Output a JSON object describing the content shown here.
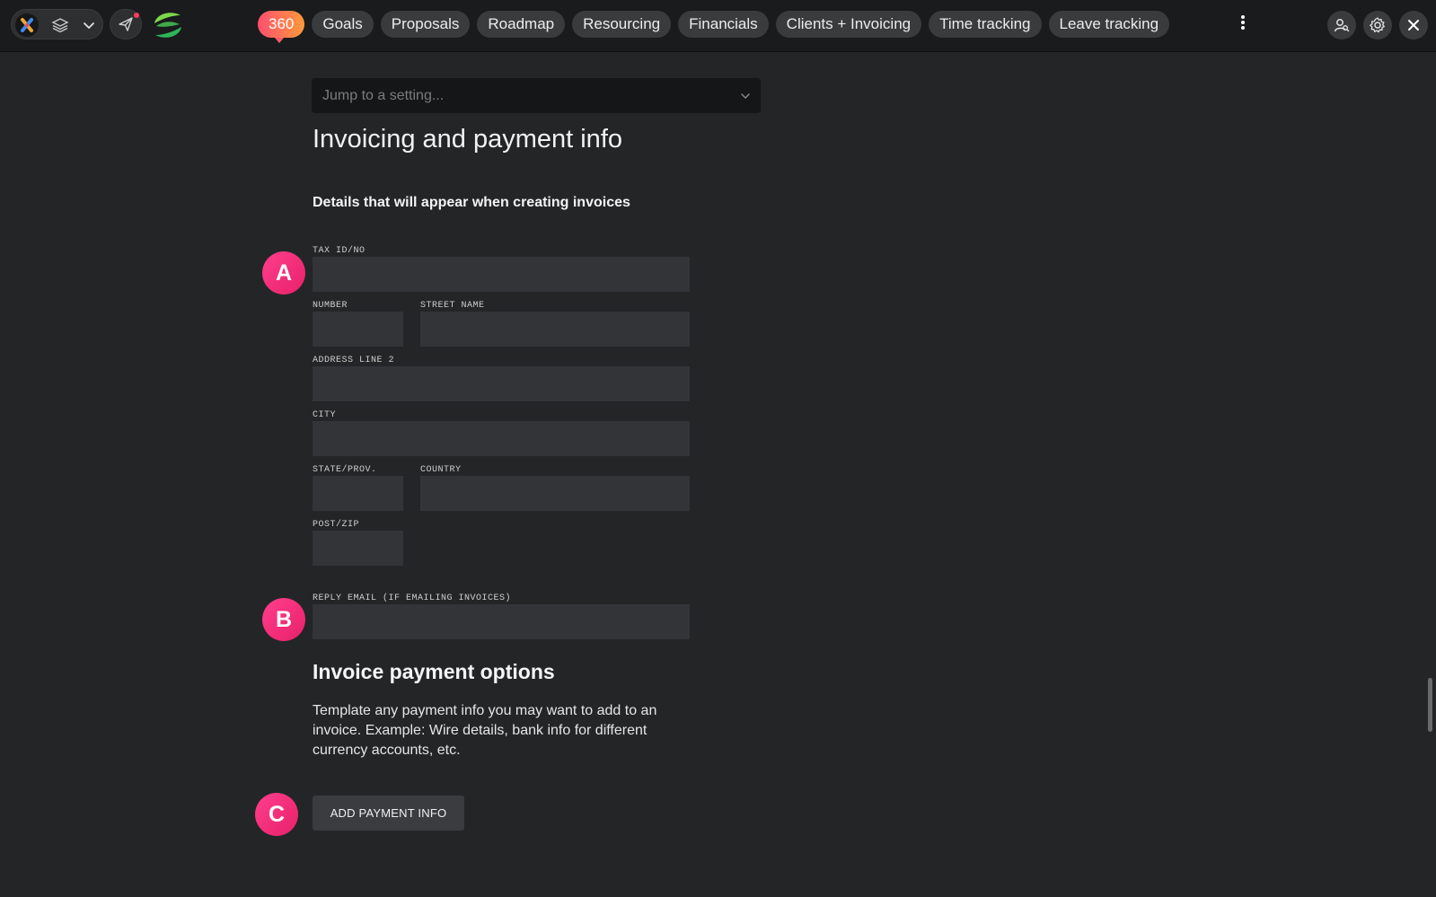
{
  "topbar": {
    "tabs": [
      {
        "label": "360"
      },
      {
        "label": "Goals"
      },
      {
        "label": "Proposals"
      },
      {
        "label": "Roadmap"
      },
      {
        "label": "Resourcing"
      },
      {
        "label": "Financials"
      },
      {
        "label": "Clients + Invoicing"
      },
      {
        "label": "Time tracking"
      },
      {
        "label": "Leave tracking"
      }
    ],
    "icons": [
      "app-logo-icon",
      "layers-icon",
      "chevron-down-icon",
      "send-icon",
      "brand-logo-icon",
      "more-vertical-icon",
      "user-search-icon",
      "gear-icon",
      "close-icon"
    ],
    "accent": "#ff4f6e"
  },
  "settings_search": {
    "placeholder": "Jump to a setting..."
  },
  "invoicing": {
    "title": "Invoicing and payment info",
    "subtitle": "Details that will appear when creating invoices",
    "fields": {
      "tax_id": {
        "label": "TAX ID/NO",
        "value": ""
      },
      "number": {
        "label": "NUMBER",
        "value": ""
      },
      "street_name": {
        "label": "STREET NAME",
        "value": ""
      },
      "address_line_2": {
        "label": "ADDRESS LINE 2",
        "value": ""
      },
      "city": {
        "label": "CITY",
        "value": ""
      },
      "state": {
        "label": "STATE/PROV.",
        "value": ""
      },
      "country": {
        "label": "COUNTRY",
        "value": ""
      },
      "post_zip": {
        "label": "POST/ZIP",
        "value": ""
      },
      "reply_email": {
        "label": "REPLY EMAIL (IF EMAILING INVOICES)",
        "value": ""
      }
    }
  },
  "payment_options": {
    "title": "Invoice payment options",
    "description": "Template any payment info you may want to add to an invoice. Example: Wire details, bank info for different currency accounts, etc.",
    "add_button": "ADD PAYMENT INFO"
  },
  "markers": {
    "a": "A",
    "b": "B",
    "c": "C",
    "color": "#f0267a"
  }
}
